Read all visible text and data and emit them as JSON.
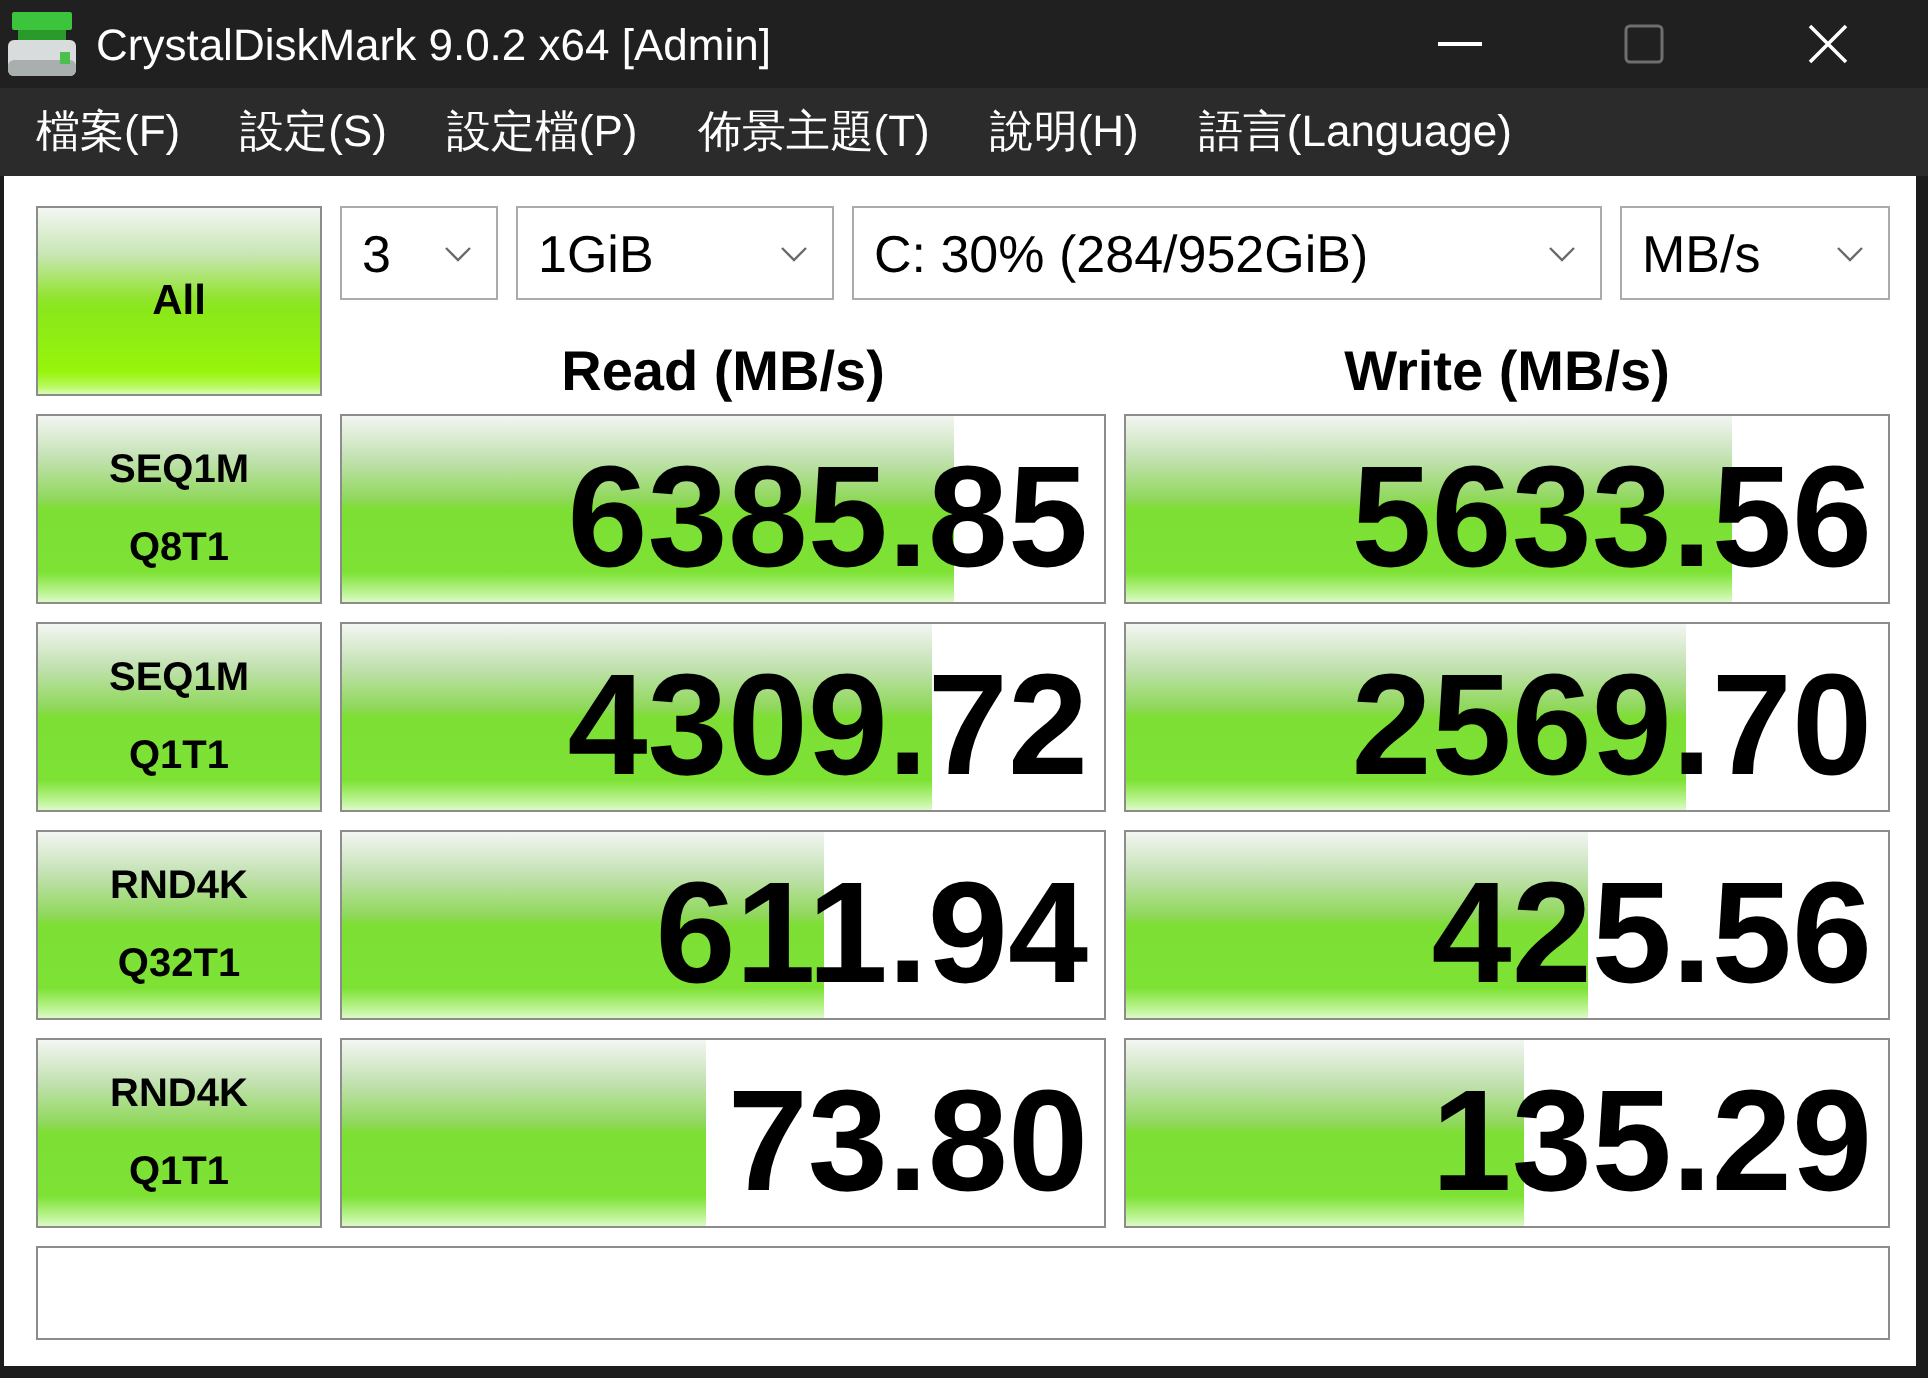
{
  "window": {
    "title": "CrystalDiskMark 9.0.2 x64 [Admin]",
    "controls": [
      {
        "kind": "minimize",
        "disabled": false
      },
      {
        "kind": "maximize",
        "disabled": true
      },
      {
        "kind": "close",
        "disabled": false
      }
    ]
  },
  "menu": [
    "檔案(F)",
    "設定(S)",
    "設定檔(P)",
    "佈景主題(T)",
    "說明(H)",
    "語言(Language)"
  ],
  "all_button": "All",
  "dropdowns": [
    {
      "value": "3"
    },
    {
      "value": "1GiB"
    },
    {
      "value": "C: 30% (284/952GiB)"
    },
    {
      "value": "MB/s"
    }
  ],
  "columns": [
    "Read (MB/s)",
    "Write (MB/s)"
  ],
  "tests": [
    {
      "label": [
        "SEQ1M",
        "Q8T1"
      ],
      "read": {
        "reading": "6385.85",
        "level": 0.803
      },
      "write": {
        "reading": "5633.56",
        "level": 0.795
      }
    },
    {
      "label": [
        "SEQ1M",
        "Q1T1"
      ],
      "read": {
        "reading": "4309.72",
        "level": 0.774
      },
      "write": {
        "reading": "2569.70",
        "level": 0.735
      }
    },
    {
      "label": [
        "RND4K",
        "Q32T1"
      ],
      "read": {
        "reading": "611.94",
        "level": 0.633
      },
      "write": {
        "reading": "425.56",
        "level": 0.606
      }
    },
    {
      "label": [
        "RND4K",
        "Q1T1"
      ],
      "read": {
        "reading": "73.80",
        "level": 0.478
      },
      "write": {
        "reading": "135.29",
        "level": 0.522
      }
    }
  ]
}
